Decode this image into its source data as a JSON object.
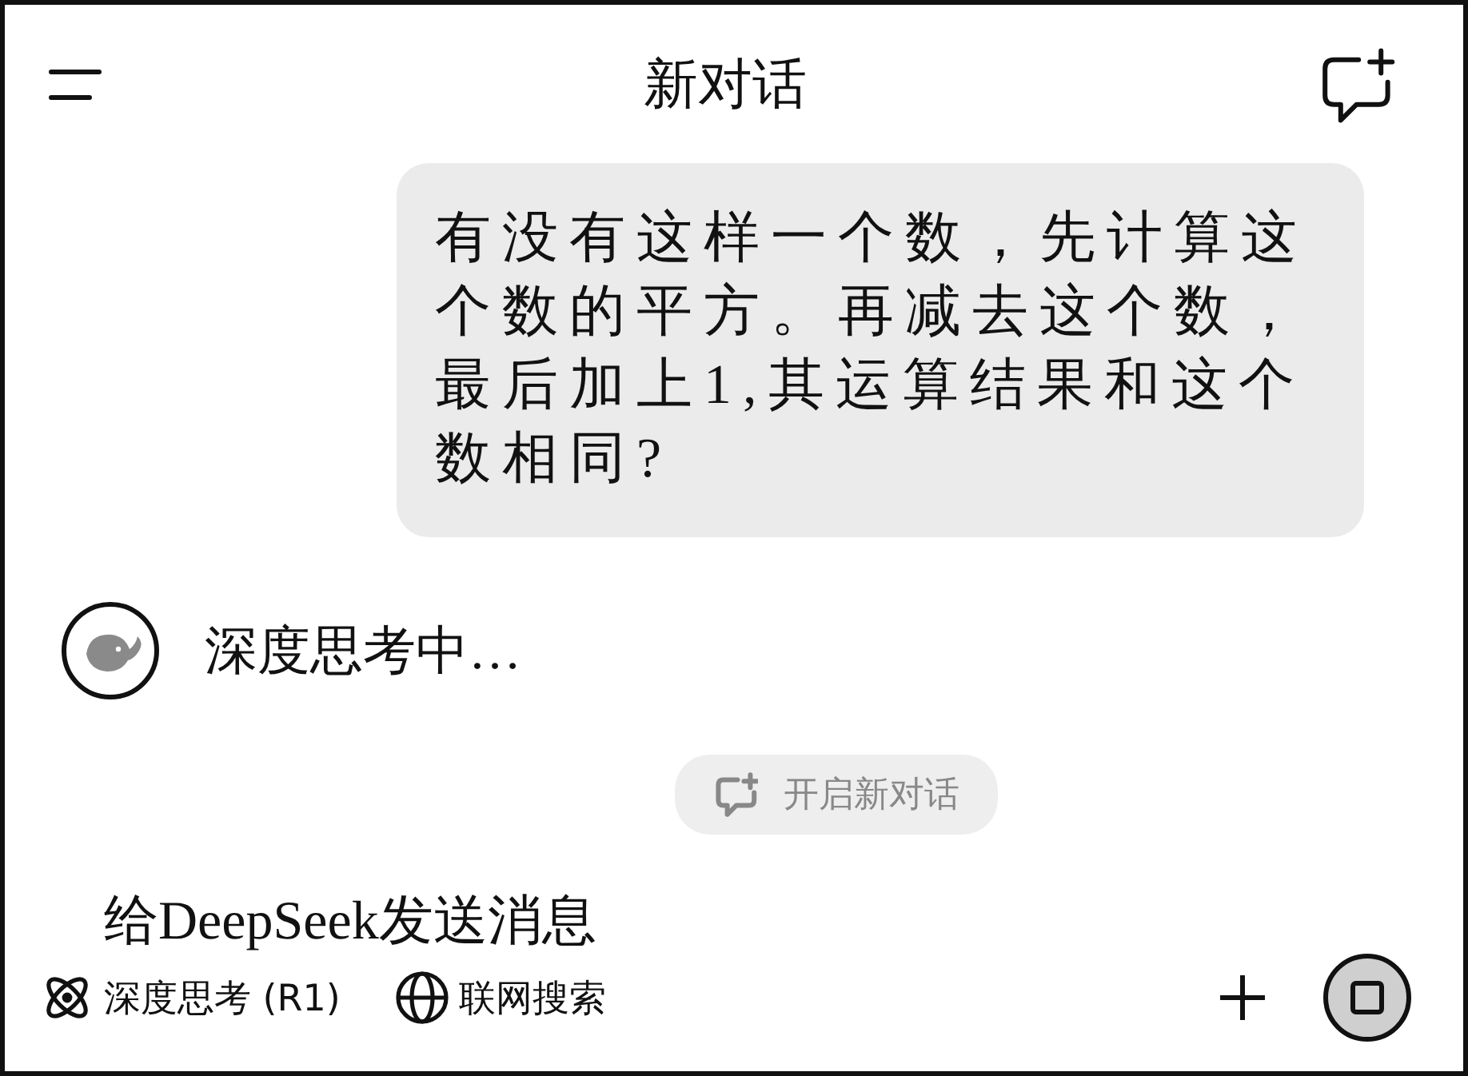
{
  "header": {
    "title": "新对话"
  },
  "messages": [
    {
      "kind": "user",
      "text": "有没有这样一个数，先计算这个数的平方。再减去这个数，最后加上1,其运算结果和这个数相同?"
    },
    {
      "kind": "assistant",
      "text": "深度思考中…"
    }
  ],
  "new_chat_chip": {
    "label": "开启新对话"
  },
  "composer": {
    "placeholder": "给DeepSeek发送消息"
  },
  "toolbar": [
    {
      "kind": "deep-think",
      "label": "深度思考 (R1)"
    },
    {
      "kind": "web-search",
      "label": "联网搜索"
    }
  ]
}
